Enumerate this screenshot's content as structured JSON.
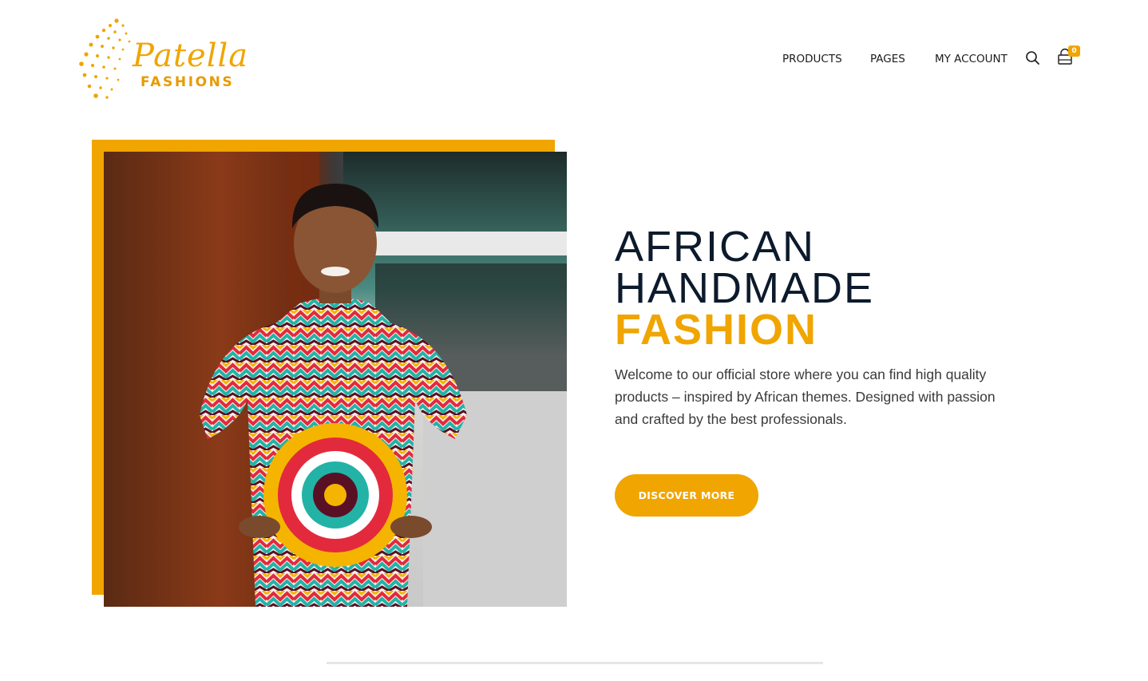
{
  "brand": {
    "logo_word": "Patella",
    "logo_sub": "FASHIONS",
    "accent_color": "#f0a500",
    "heading_color": "#0c1a2c"
  },
  "nav": {
    "items": [
      {
        "label": "PRODUCTS"
      },
      {
        "label": "PAGES"
      },
      {
        "label": "MY ACCOUNT"
      }
    ],
    "search_icon": "search-icon",
    "cart_icon": "shopping-bag-icon",
    "cart_count": "0"
  },
  "hero": {
    "title_line1": "AFRICAN",
    "title_line2": "HANDMADE",
    "title_line3": "FASHION",
    "description": "Welcome to our official store where you can find high quality products – inspired by African themes. Designed with passion and crafted by the best professionals.",
    "cta_label": "DISCOVER MORE"
  }
}
